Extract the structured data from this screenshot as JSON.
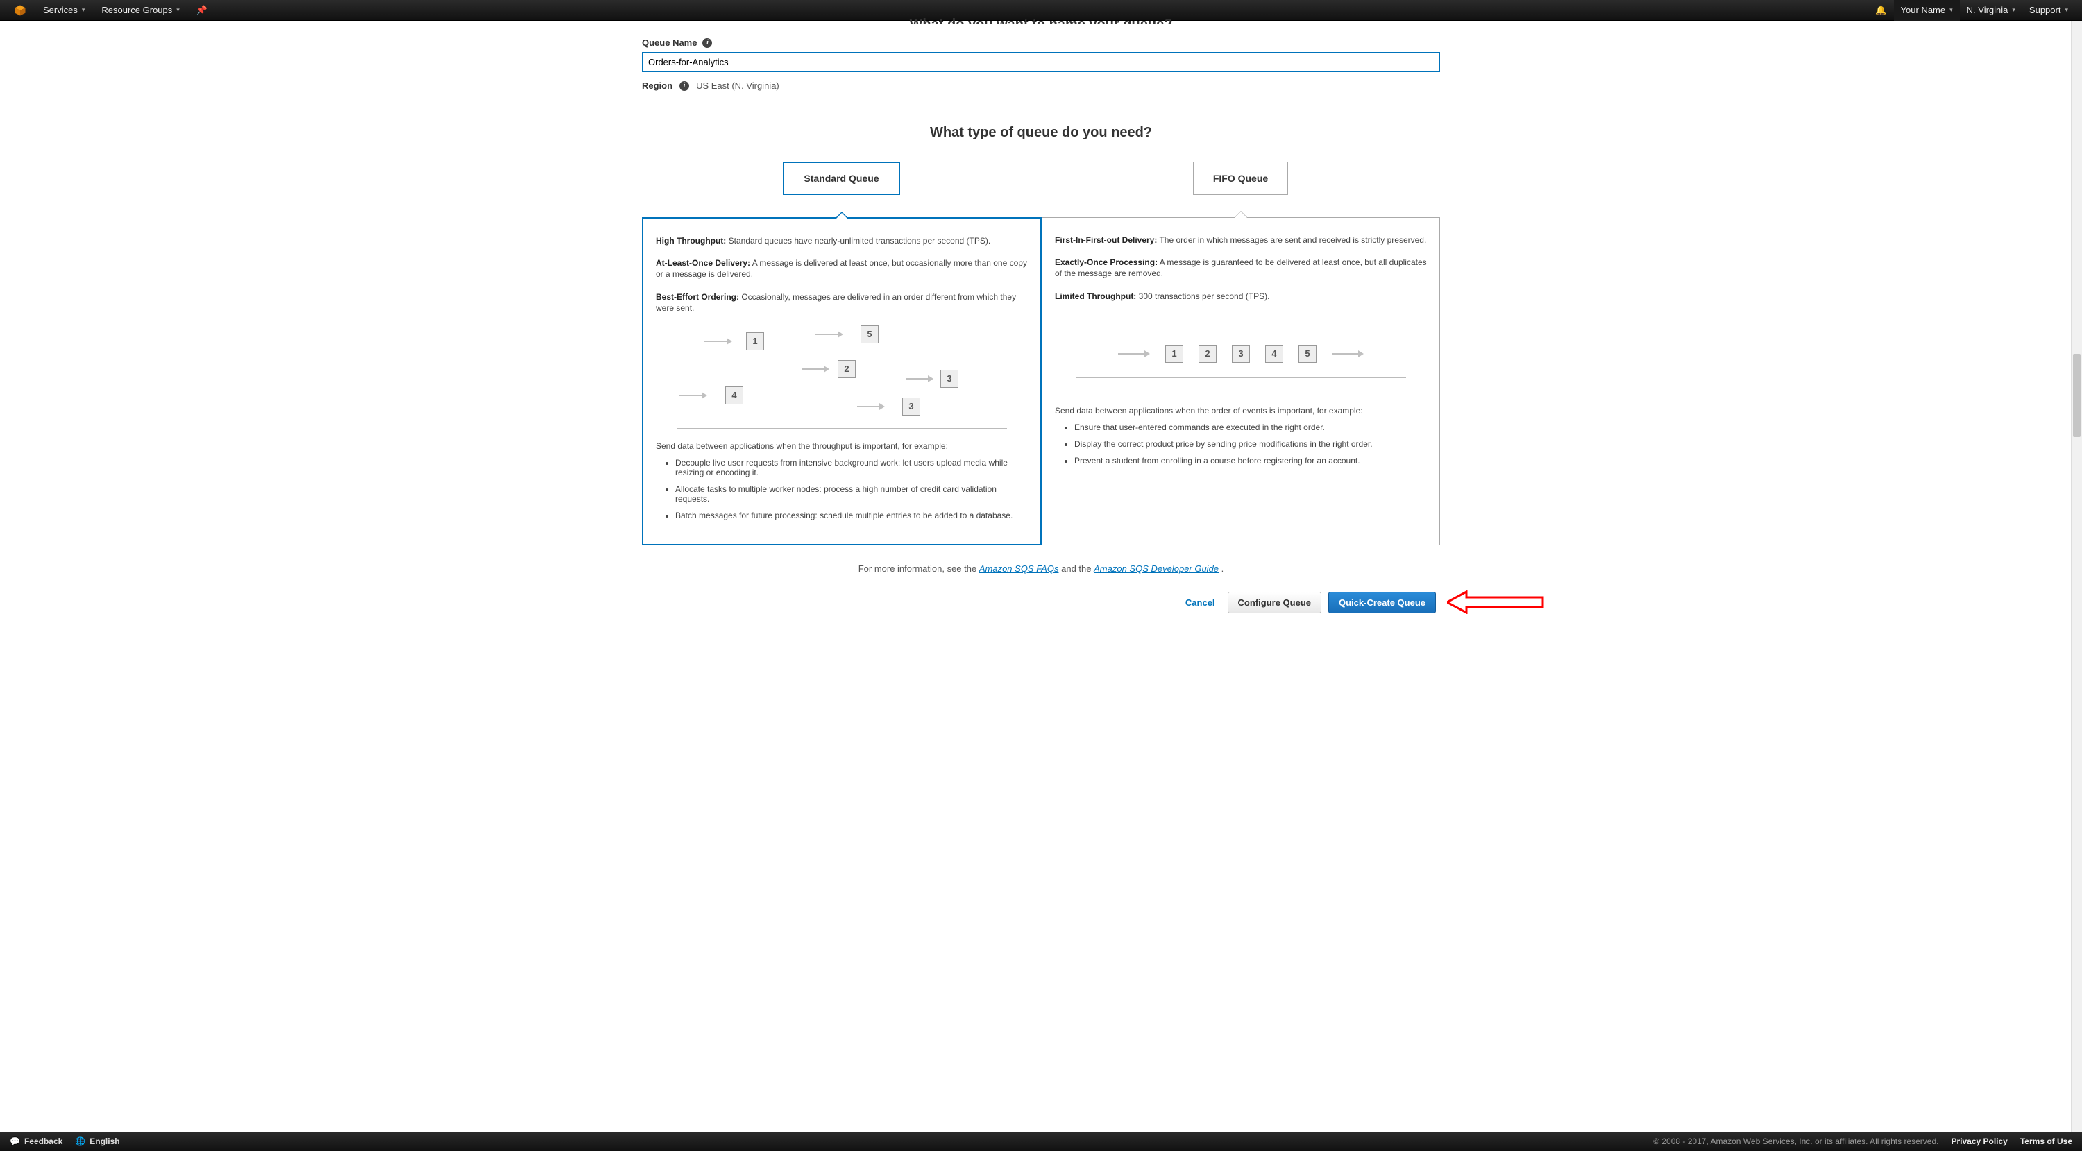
{
  "topbar": {
    "services": "Services",
    "resource_groups": "Resource Groups",
    "user": "Your Name",
    "region": "N. Virginia",
    "support": "Support"
  },
  "page": {
    "title_cut": "What do you want to name your queue?",
    "queue_name_label": "Queue Name",
    "queue_name_value": "Orders-for-Analytics",
    "region_label": "Region",
    "region_value": "US East (N. Virginia)",
    "queue_type_heading": "What type of queue do you need?"
  },
  "tabs": {
    "standard": "Standard Queue",
    "fifo": "FIFO Queue"
  },
  "standard": {
    "features": [
      {
        "title": "High Throughput:",
        "body": " Standard queues have nearly-unlimited transactions per second (TPS)."
      },
      {
        "title": "At-Least-Once Delivery:",
        "body": " A message is delivered at least once, but occasionally more than one copy or a message is delivered."
      },
      {
        "title": "Best-Effort Ordering:",
        "body": " Occasionally, messages are delivered in an order different from which they were sent."
      }
    ],
    "diagram_numbers": [
      "1",
      "5",
      "2",
      "3",
      "4",
      "3"
    ],
    "usecase_intro": "Send data between applications when the throughput is important, for example:",
    "usecases": [
      "Decouple live user requests from intensive background work: let users upload media while resizing or encoding it.",
      "Allocate tasks to multiple worker nodes: process a high number of credit card validation requests.",
      "Batch messages for future processing: schedule multiple entries to be added to a database."
    ]
  },
  "fifo": {
    "features": [
      {
        "title": "First-In-First-out Delivery:",
        "body": " The order in which messages are sent and received is strictly preserved."
      },
      {
        "title": "Exactly-Once Processing:",
        "body": " A message is guaranteed to be delivered at least once, but all duplicates of the message are removed."
      },
      {
        "title": "Limited Throughput:",
        "body": " 300 transactions per second (TPS)."
      }
    ],
    "diagram_numbers": [
      "1",
      "2",
      "3",
      "4",
      "5"
    ],
    "usecase_intro": "Send data between applications when the order of events is important, for example:",
    "usecases": [
      "Ensure that user-entered commands are executed in the right order.",
      "Display the correct product price by sending price modifications in the right order.",
      "Prevent a student from enrolling in a course before registering for an account."
    ]
  },
  "more_info": {
    "prefix": "For more information, see the ",
    "link1": "Amazon SQS FAQs",
    "mid": " and the ",
    "link2": "Amazon SQS Developer Guide",
    "suffix": "."
  },
  "actions": {
    "cancel": "Cancel",
    "configure": "Configure Queue",
    "quick_create": "Quick-Create Queue"
  },
  "footer": {
    "feedback": "Feedback",
    "english": "English",
    "copyright": "© 2008 - 2017, Amazon Web Services, Inc. or its affiliates. All rights reserved.",
    "privacy": "Privacy Policy",
    "terms": "Terms of Use"
  }
}
